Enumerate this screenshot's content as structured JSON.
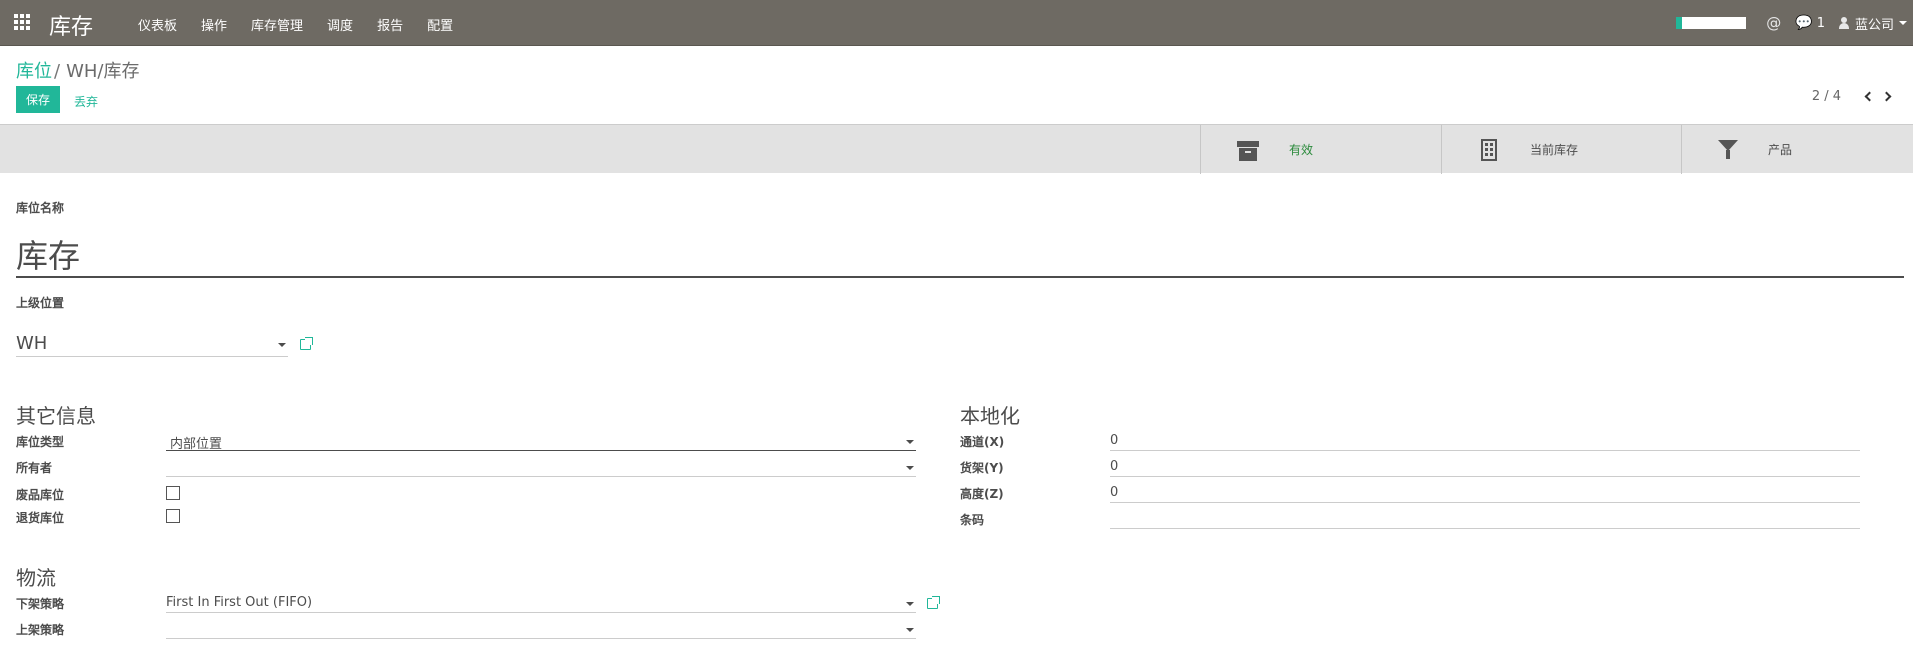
{
  "navbar": {
    "app_title": "库存",
    "menu": [
      "仪表板",
      "操作",
      "库存管理",
      "调度",
      "报告",
      "配置"
    ],
    "chat_count": "1",
    "user_name": "蓝公司"
  },
  "breadcrumb": {
    "parent": "库位",
    "separator": "/",
    "current": "WH/库存"
  },
  "actions": {
    "save": "保存",
    "discard": "丢弃"
  },
  "pager": {
    "value": "2 / 4"
  },
  "button_box": {
    "active": "有效",
    "current_stock": "当前库存",
    "products": "产品"
  },
  "form": {
    "name_label": "库位名称",
    "name_value": "库存",
    "parent_label": "上级位置",
    "parent_value": "WH",
    "other_info": {
      "title": "其它信息",
      "location_type_label": "库位类型",
      "location_type_value": "内部位置",
      "owner_label": "所有者",
      "owner_value": "",
      "scrap_label": "废品库位",
      "scrap_checked": false,
      "return_label": "退货库位",
      "return_checked": false
    },
    "localization": {
      "title": "本地化",
      "aisle_label": "通道(X)",
      "aisle_value": "0",
      "shelf_label": "货架(Y)",
      "shelf_value": "0",
      "height_label": "高度(Z)",
      "height_value": "0",
      "barcode_label": "条码",
      "barcode_value": ""
    },
    "logistics": {
      "title": "物流",
      "removal_label": "下架策略",
      "removal_value": "First In First Out (FIFO)",
      "putaway_label": "上架策略",
      "putaway_value": ""
    }
  }
}
